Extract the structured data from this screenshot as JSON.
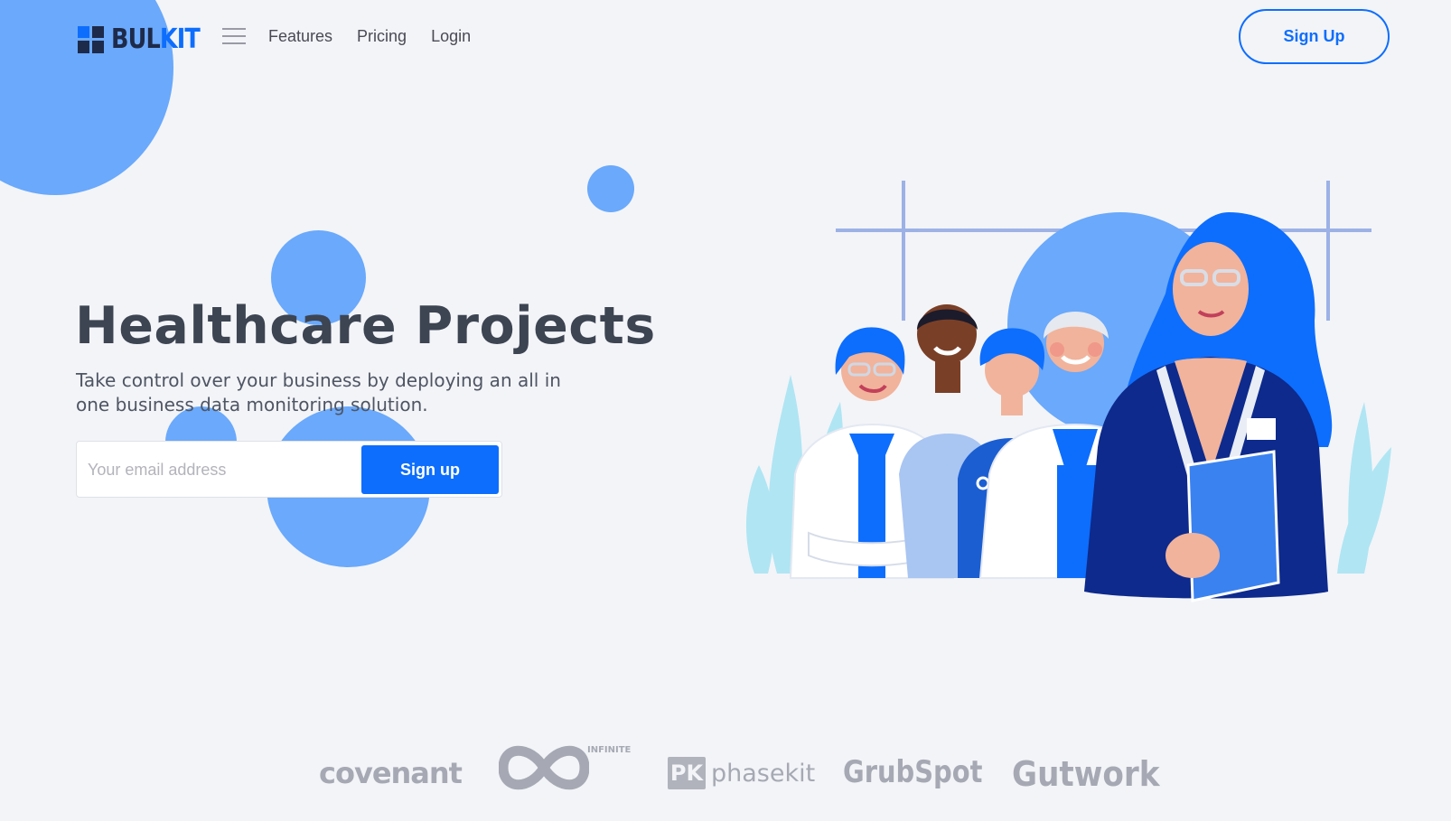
{
  "nav": {
    "logo_text_dark": "BUL",
    "logo_text_accent": "KIT",
    "links": [
      "Features",
      "Pricing",
      "Login"
    ],
    "signup_label": "Sign Up"
  },
  "hero": {
    "title": "Healthcare Projects",
    "subtitle": "Take control over your business by deploying an all in one business data monitoring solution.",
    "email_placeholder": "Your email address",
    "email_value": "",
    "signup_label": "Sign up"
  },
  "brands": {
    "covenant": "covenant",
    "infinite": "INFINITE",
    "phasekit_mark": "PK",
    "phasekit": "phasekit",
    "grubspot": "GrubSpot",
    "gutwork": "Gutwork"
  },
  "colors": {
    "accent": "#0d6efd",
    "blob": "#6aa9fb",
    "background": "#f3f4f8",
    "brand_gray": "#a6a9b3"
  },
  "icons": {
    "menu": "hamburger-menu-icon",
    "logo": "bulkit-logo-icon"
  }
}
